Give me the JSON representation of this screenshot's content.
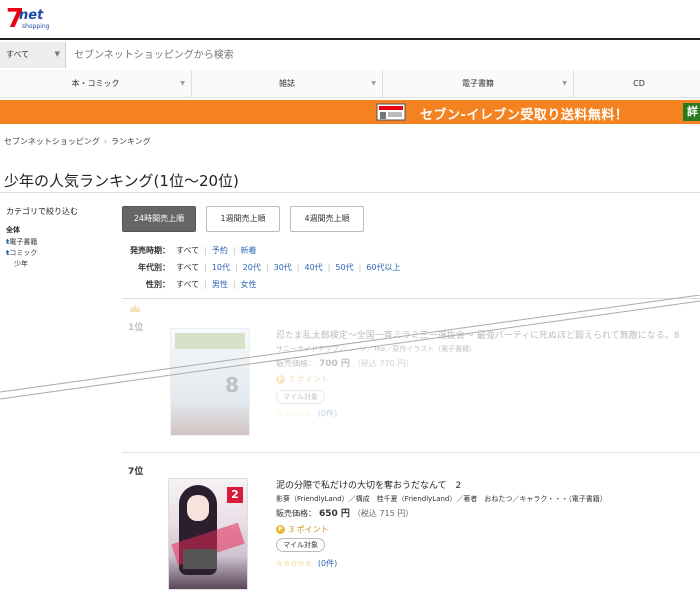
{
  "logo": {
    "seven": "7",
    "net": "net",
    "shopping": "shopping"
  },
  "search": {
    "category": "すべて",
    "placeholder": "セブンネットショッピングから検索"
  },
  "nav": [
    "本・コミック",
    "雑誌",
    "電子書籍",
    "CD"
  ],
  "banner": {
    "text": "セブン-イレブン受取り送料無料！",
    "detail": "詳"
  },
  "breadcrumb": [
    "セブンネットショッピング",
    "ランキング"
  ],
  "page_title": "少年の人気ランキング(1位〜20位)",
  "sidebar": {
    "heading": "カテゴリで絞り込む",
    "all": "全体",
    "items": [
      "電子書籍",
      "コミック"
    ],
    "sub": "少年"
  },
  "period_tabs": [
    "24時間売上順",
    "1週間売上順",
    "4週間売上順"
  ],
  "filters": {
    "release": {
      "label": "発売時期：",
      "options": [
        "すべて",
        "予約",
        "新着"
      ]
    },
    "age": {
      "label": "年代別：",
      "options": [
        "すべて",
        "10代",
        "20代",
        "30代",
        "40代",
        "50代",
        "60代以上"
      ]
    },
    "gender": {
      "label": "性別：",
      "options": [
        "すべて",
        "男性",
        "女性"
      ]
    }
  },
  "items": [
    {
      "rank": "1位",
      "title": "忍たま乱太郎検定〜全国一斉ミラミ三一選抜会〜 最強パーティに死ぬほど鍛えられて無敵になる。8",
      "author": "サニーサイドアップ／...　ソ／Tea／原作イラスト（電子書籍）",
      "price_label": "販売価格：",
      "price": "700 円",
      "tax": "（税込 770 円）",
      "points": "3 ポイント",
      "mile": "マイル対象",
      "stars": "☆☆☆☆☆",
      "review_count": "(0件)"
    },
    {
      "rank": "7位",
      "title": "泥の分際で私だけの大切を奪おうだなんて　2",
      "author": "影葵（FriendlyLand）／構成　桂千夏（FriendlyLand）／著者　おねたつ／キャラク・・・（電子書籍）",
      "price_label": "販売価格：",
      "price": "650 円",
      "tax": "（税込 715 円）",
      "points": "3 ポイント",
      "mile": "マイル対象",
      "stars": "☆☆☆☆☆",
      "review_count": "(0件)"
    }
  ],
  "colors": {
    "orange": "#f58220",
    "link": "#2a66b5",
    "point": "#e8b530"
  }
}
